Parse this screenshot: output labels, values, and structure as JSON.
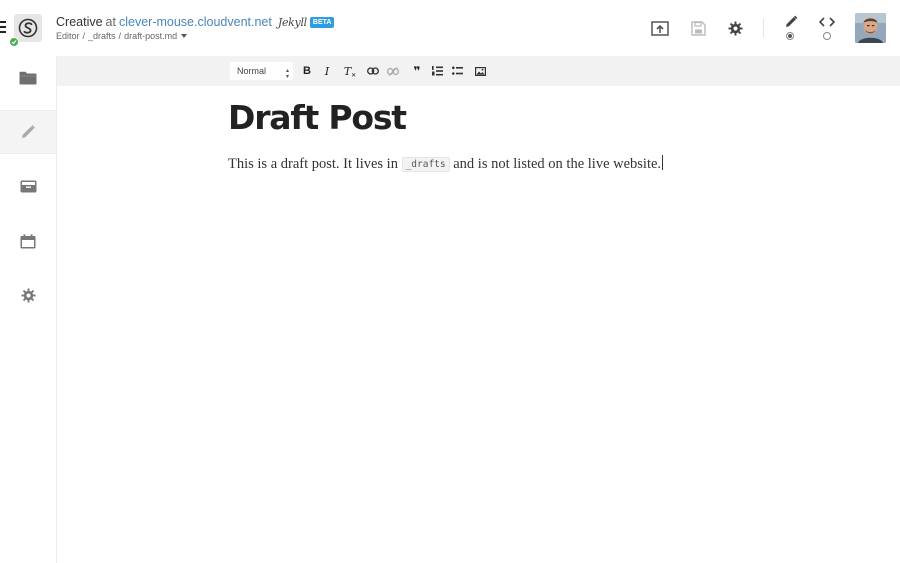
{
  "header": {
    "site_name": "Creative",
    "at_text": "at",
    "host": "clever-mouse.cloudvent.net",
    "ssg_name": "Jekyll",
    "beta_badge": "BETA",
    "breadcrumb": {
      "items": [
        "Editor",
        "_drafts",
        "draft-post.md"
      ],
      "separator": "/"
    },
    "toolbar_icons": [
      "publish-icon",
      "save-icon",
      "settings-icon",
      "visual-editor-icon",
      "source-editor-icon"
    ],
    "editor_mode_selected": "visual"
  },
  "sidebar": {
    "items": [
      {
        "name": "files",
        "icon": "folder-icon",
        "active": false
      },
      {
        "name": "editor",
        "icon": "pencil-icon",
        "active": true
      },
      {
        "name": "collections",
        "icon": "inbox-icon",
        "active": false
      },
      {
        "name": "schedule",
        "icon": "calendar-icon",
        "active": false
      },
      {
        "name": "settings",
        "icon": "gear-icon",
        "active": false
      }
    ]
  },
  "format_toolbar": {
    "style_select": "Normal",
    "buttons": [
      "bold-icon",
      "italic-icon",
      "clear-format-icon",
      "link-icon",
      "unlink-icon",
      "blockquote-icon",
      "ordered-list-icon",
      "unordered-list-icon",
      "image-icon"
    ],
    "bold_glyph": "B",
    "italic_glyph": "I",
    "clear_glyph": "T",
    "quote_glyph": "❞"
  },
  "document": {
    "title": "Draft Post",
    "body_before": "This is a draft post. It lives in ",
    "body_code": "_drafts",
    "body_after": " and is not listed on the live website."
  },
  "colors": {
    "accent": "#4a86b7",
    "badge": "#2f9ee0",
    "status_ok": "#4cae4c"
  }
}
